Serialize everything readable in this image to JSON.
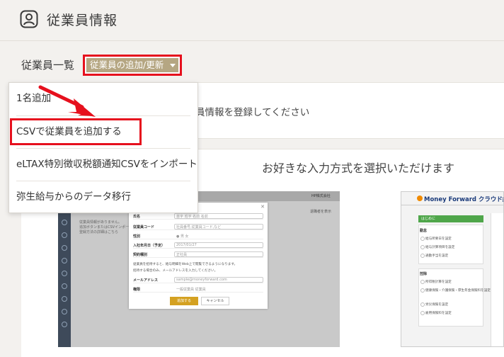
{
  "header": {
    "title": "従業員情報",
    "icon": "user-icon"
  },
  "section": {
    "title": "従業員一覧",
    "add_button_label": "従業員の追加/更新"
  },
  "notice": {
    "text": "員情報を登録してください"
  },
  "card": {
    "heading": "お好きな入力方式を選択いただけます"
  },
  "dropdown": {
    "items": [
      "1名追加",
      "CSVで従業員を追加する",
      "eLTAX特別徴収税額通知CSVをインポート",
      "弥生給与からのデータ移行"
    ]
  },
  "preview_left": {
    "topbar_right": "HP株式会社",
    "notes": [
      "従業員情報がありません。",
      "追加ボタンまたはCSVインポートで",
      "登録方法の詳細はこちら"
    ],
    "side_note": "退職者を表示",
    "modal": {
      "rows": [
        {
          "label": "氏名",
          "value": "苗字  姓字        名前  名前"
        },
        {
          "label": "従業員コード",
          "value": "社員番号,従業員コード,など"
        },
        {
          "label": "性別",
          "value": "● 男   女"
        },
        {
          "label": "入社年月日（予定）",
          "value": "2017/01/27"
        },
        {
          "label": "契約種別",
          "value": "正社員"
        }
      ],
      "message1": "従業員を招待すると、給与明細をWeb上で閲覧できるようになります。",
      "message2": "招待する場合のみ、メールアドレスを入力してください。",
      "rows2": [
        {
          "label": "メールアドレス",
          "value": "sample@moneyforward.com"
        },
        {
          "label": "権限",
          "value": "一般従業員      従業員"
        }
      ],
      "register_label": "追加する",
      "cancel_label": "キャンセル"
    }
  },
  "preview_right": {
    "logo": "Money Forward クラウド給与",
    "bar_label": "はじめに",
    "section1": "勤怠",
    "items1": [
      "給与所要日を設定",
      "給与計算項目を設定",
      "通勤手当を設定"
    ],
    "section2": "控除",
    "items2": [
      "所得税計算を設定",
      "健康保険・介護保険・厚生年金保険料を設定",
      "労災保険を設定",
      "雇用保険料を設定"
    ]
  }
}
